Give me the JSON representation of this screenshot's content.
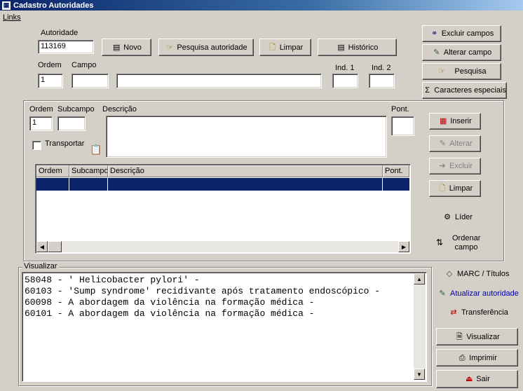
{
  "window": {
    "title": "Cadastro Autoridades"
  },
  "menu": {
    "links": "Links"
  },
  "header": {
    "autoridade_label": "Autoridade",
    "autoridade_value": "113169",
    "ordem_label": "Ordem",
    "ordem_value": "1",
    "campo_label": "Campo",
    "campo_value": "",
    "campo_desc_value": "",
    "ind1_label": "Ind. 1",
    "ind1_value": "",
    "ind2_label": "Ind. 2",
    "ind2_value": ""
  },
  "toolbar": {
    "novo": "Novo",
    "pesquisa_autoridade": "Pesquisa autoridade",
    "limpar": "Limpar",
    "historico": "Histórico"
  },
  "right_buttons": {
    "excluir_campos": "Excluir campos",
    "alterar_campo": "Alterar campo",
    "pesquisa": "Pesquisa",
    "caracteres_especiais": "Caracteres especiais"
  },
  "subfield": {
    "ordem_label": "Ordem",
    "ordem_value": "1",
    "subcampo_label": "Subcampo",
    "subcampo_value": "",
    "descricao_label": "Descrição",
    "descricao_value": "",
    "pont_label": "Pont.",
    "pont_value": "",
    "transportar_label": "Transportar",
    "transportar_checked": false
  },
  "sub_buttons": {
    "inserir": "Inserir",
    "alterar": "Alterar",
    "excluir": "Excluir",
    "limpar": "Limpar",
    "lider": "Líder",
    "ordenar_campo_1": "Ordenar",
    "ordenar_campo_2": "campo"
  },
  "grid": {
    "columns": [
      "Ordem",
      "Subcampo",
      "Descrição",
      "Pont."
    ],
    "rows": [
      {
        "ordem": "",
        "subcampo": "",
        "descricao": "",
        "pont": "",
        "selected": true
      }
    ]
  },
  "visualizar": {
    "label": "Visualizar",
    "lines": [
      "58048 - ' Helicobacter pylori' -",
      "60103 - 'Sump syndrome' recidivante após tratamento endoscópico -",
      "60098 - A abordagem da violência na formação médica -",
      "60101 - A abordagem da violência na formação médica -"
    ]
  },
  "bottom_right": {
    "marc_titulos": "MARC / Títulos",
    "atualizar_autoridade": "Atualizar autoridade",
    "transferencia": "Transferência",
    "visualizar": "Visualizar",
    "imprimir": "Imprimir",
    "sair": "Sair"
  },
  "colors": {
    "title_bar": "#0a246a",
    "selection": "#0a246a",
    "link_blue": "#0000a0"
  }
}
